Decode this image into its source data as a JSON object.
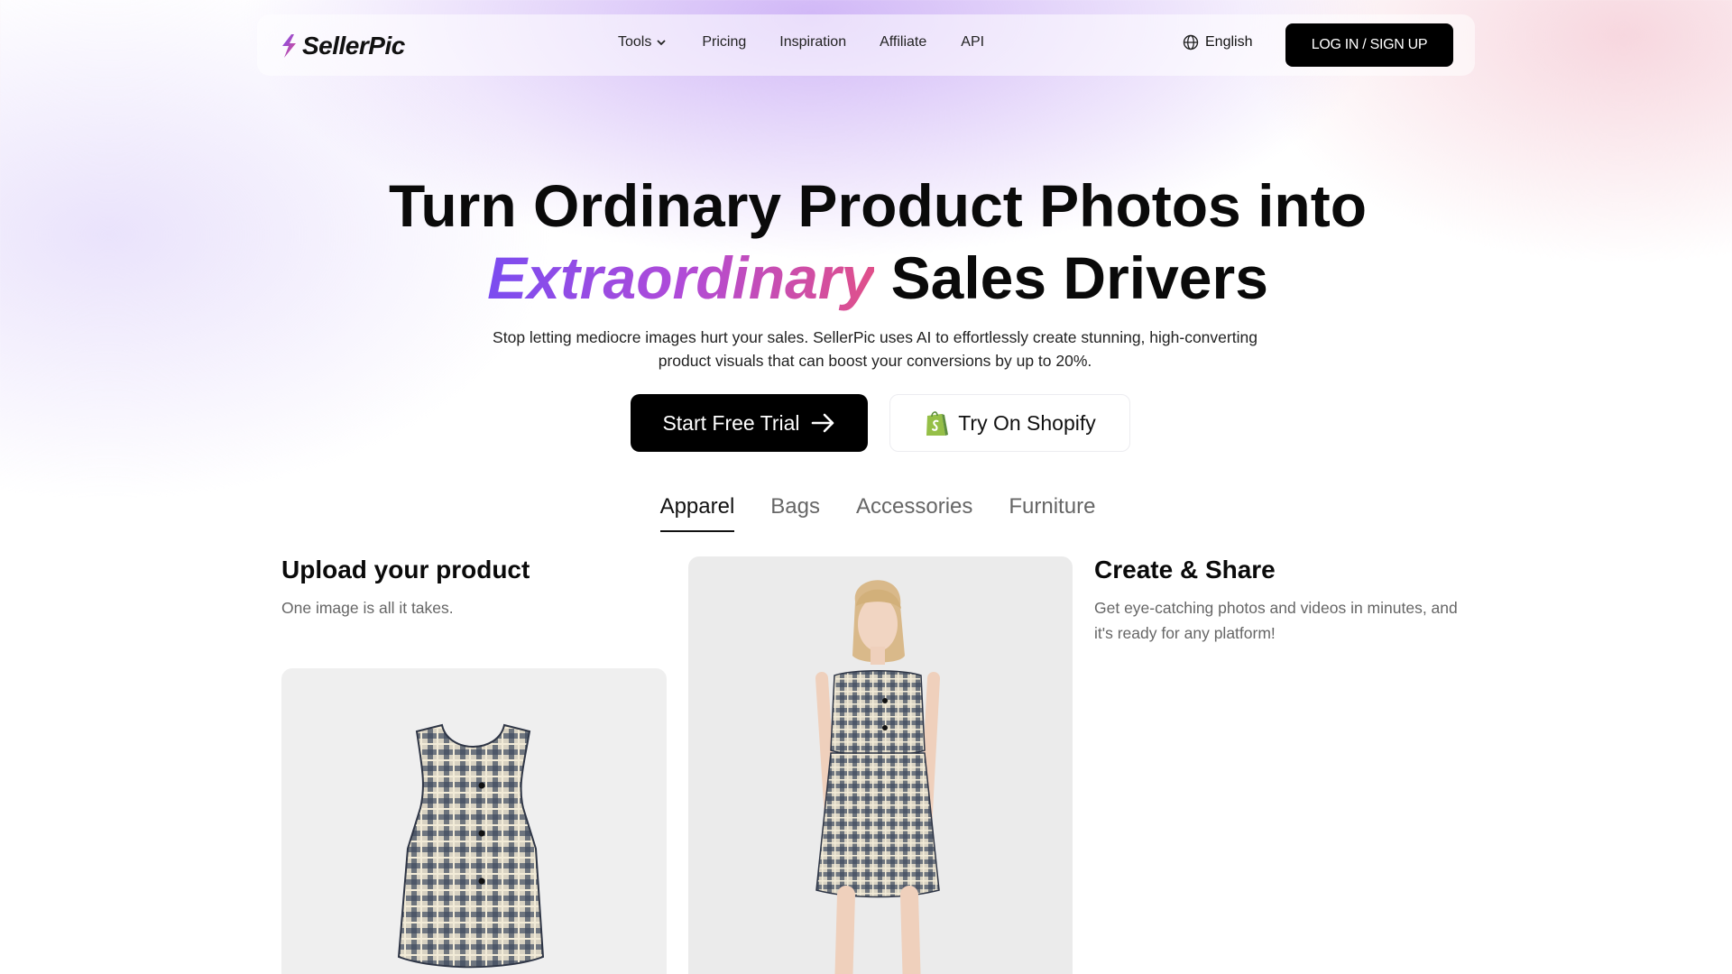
{
  "nav": {
    "logo_text": "SellerPic",
    "links": [
      {
        "label": "Tools",
        "has_dropdown": true
      },
      {
        "label": "Pricing"
      },
      {
        "label": "Inspiration"
      },
      {
        "label": "Affiliate"
      },
      {
        "label": "API"
      }
    ],
    "language": "English",
    "login_label": "LOG IN / SIGN UP"
  },
  "hero": {
    "title_line1": "Turn Ordinary Product Photos into",
    "title_highlight": "Extraordinary",
    "title_line2_rest": " Sales Drivers",
    "subtitle_line1": "Stop letting mediocre images hurt your sales. SellerPic uses AI to effortlessly create stunning, high-converting",
    "subtitle_line2": "product visuals that can boost your conversions by up to 20%.",
    "primary_cta": "Start Free Trial",
    "secondary_cta": "Try On Shopify"
  },
  "tabs": [
    {
      "label": "Apparel",
      "active": true
    },
    {
      "label": "Bags",
      "active": false
    },
    {
      "label": "Accessories",
      "active": false
    },
    {
      "label": "Furniture",
      "active": false
    }
  ],
  "steps": {
    "upload": {
      "title": "Upload your product",
      "desc": "One image is all it takes."
    },
    "create": {
      "title": "Create & Share",
      "desc_line1": "Get eye-catching photos and videos in minutes, and",
      "desc_line2": "it's ready for any platform!"
    }
  },
  "colors": {
    "accent_gradient_start": "#7b4cf0",
    "accent_gradient_end": "#e0508a",
    "button_dark": "#000000",
    "shopify_green": "#95bf47"
  }
}
